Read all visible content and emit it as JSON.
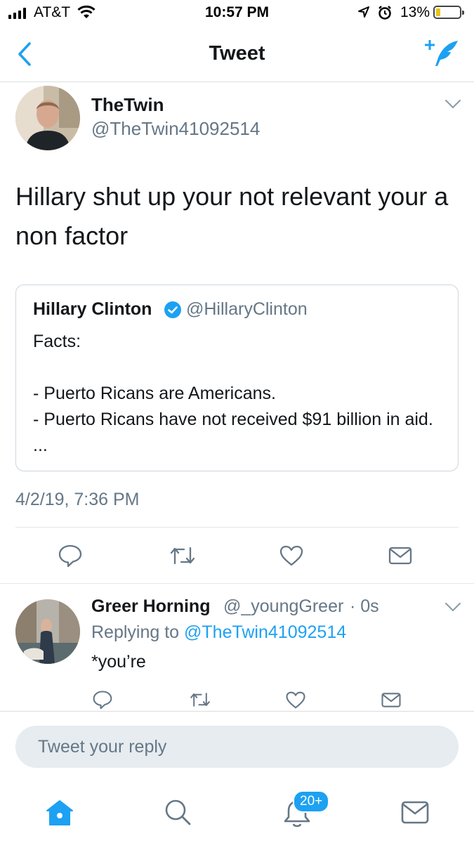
{
  "status_bar": {
    "carrier": "AT&T",
    "time": "10:57 PM",
    "battery": "13%"
  },
  "nav": {
    "title": "Tweet"
  },
  "tweet": {
    "author_name": "TheTwin",
    "author_handle": "@TheTwin41092514",
    "text": "Hillary shut up your not relevant your a non factor",
    "timestamp": "4/2/19, 7:36 PM"
  },
  "quoted_tweet": {
    "author_name": "Hillary Clinton",
    "author_handle": "@HillaryClinton",
    "text": "Facts:\n\n- Puerto Ricans are Americans.\n- Puerto Ricans have not received $91 billion in aid. ..."
  },
  "reply": {
    "author_name": "Greer Horning",
    "author_handle": "@_youngGreer",
    "time": "· 0s",
    "replying_prefix": "Replying to",
    "replying_handle": "@TheTwin41092514",
    "text": "*you’re"
  },
  "composer": {
    "placeholder": "Tweet your reply"
  },
  "tab_bar": {
    "notifications_badge": "20+"
  },
  "colors": {
    "accent": "#1da1f2",
    "secondary_text": "#657786",
    "verified": "#1da1f2",
    "battery_low": "#e8c41a"
  },
  "icons": [
    "back-chevron-icon",
    "compose-tweet-icon",
    "chevron-down-icon",
    "verified-badge-icon",
    "reply-icon",
    "retweet-icon",
    "like-icon",
    "share-icon",
    "home-icon",
    "search-icon",
    "notifications-icon",
    "messages-icon",
    "signal-icon",
    "wifi-icon",
    "location-icon",
    "alarm-icon",
    "battery-icon"
  ]
}
